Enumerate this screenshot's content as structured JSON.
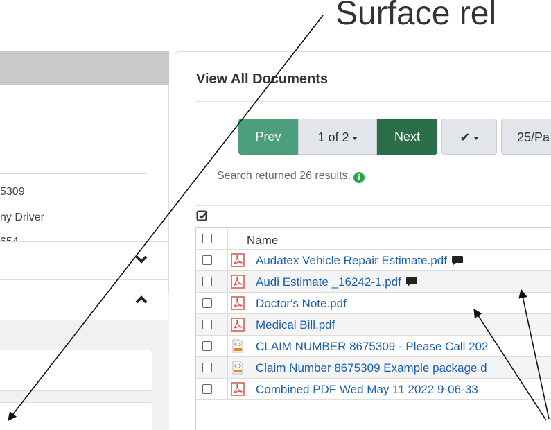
{
  "annotation": {
    "title": "Surface rel"
  },
  "left_panel": {
    "info_lines": [
      "5309",
      "ny Driver",
      "654"
    ]
  },
  "documents": {
    "title": "View All Documents",
    "pagination": {
      "prev_label": "Prev",
      "page_label": "1 of 2",
      "next_label": "Next",
      "check_label": "✔",
      "per_page_label": "25/Pa"
    },
    "results_text": "Search returned 26 results.",
    "info_glyph": "i",
    "table": {
      "header_name": "Name",
      "rows": [
        {
          "name": "Audatex Vehicle Repair Estimate.pdf",
          "type": "pdf-icon",
          "has_comment": true
        },
        {
          "name": "Audi Estimate _16242-1.pdf",
          "type": "pdf-icon",
          "has_comment": true
        },
        {
          "name": "Doctor's Note.pdf",
          "type": "pdf-icon",
          "has_comment": false
        },
        {
          "name": "Medical Bill.pdf",
          "type": "pdf-icon",
          "has_comment": false
        },
        {
          "name": "CLAIM NUMBER 8675309 - Please Call 202",
          "type": "html-icon",
          "has_comment": false
        },
        {
          "name": "Claim Number 8675309 Example package d",
          "type": "html-icon",
          "has_comment": false
        },
        {
          "name": "Combined PDF Wed May 11 2022 9-06-33",
          "type": "pdf-icon",
          "has_comment": false
        }
      ]
    }
  },
  "colors": {
    "prev": "#4c9f7d",
    "next": "#2b6e48",
    "link": "#1a5fb4",
    "pdf": "#d9534f",
    "info": "#27a844"
  }
}
